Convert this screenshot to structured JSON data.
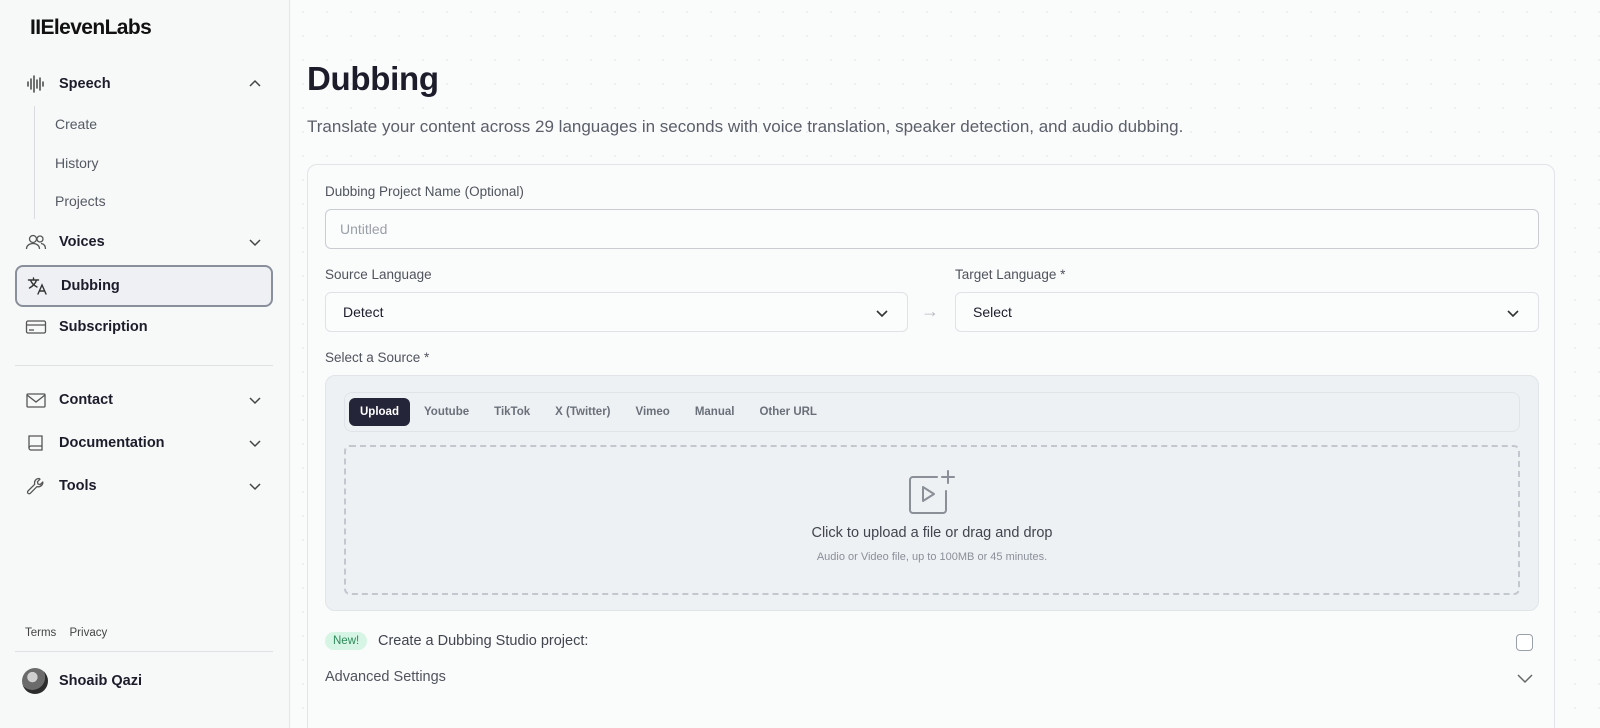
{
  "brand": {
    "logo_text": "IIElevenLabs"
  },
  "sidebar": {
    "items": [
      {
        "label": "Speech",
        "icon": "waveform-icon",
        "expanded": true
      },
      {
        "label": "Voices",
        "icon": "users-icon"
      },
      {
        "label": "Dubbing",
        "icon": "translate-icon",
        "active": true
      },
      {
        "label": "Subscription",
        "icon": "credit-card-icon"
      },
      {
        "label": "Contact",
        "icon": "mail-icon"
      },
      {
        "label": "Documentation",
        "icon": "book-icon"
      },
      {
        "label": "Tools",
        "icon": "wrench-icon"
      }
    ],
    "speech_sub": [
      "Create",
      "History",
      "Projects"
    ],
    "footer_links": [
      "Terms",
      "Privacy"
    ],
    "user": {
      "name": "Shoaib Qazi"
    }
  },
  "main": {
    "title": "Dubbing",
    "subtitle": "Translate your content across 29 languages in seconds with voice translation, speaker detection, and audio dubbing.",
    "project_name": {
      "label": "Dubbing Project Name (Optional)",
      "placeholder": "Untitled",
      "value": ""
    },
    "source_language": {
      "label": "Source Language",
      "value": "Detect"
    },
    "target_language": {
      "label": "Target Language *",
      "value": "Select"
    },
    "arrow": "→",
    "source": {
      "label": "Select a Source *",
      "tabs": [
        "Upload",
        "Youtube",
        "TikTok",
        "X (Twitter)",
        "Vimeo",
        "Manual",
        "Other URL"
      ],
      "active_tab": "Upload",
      "dropzone_title": "Click to upload a file or drag and drop",
      "dropzone_subtitle": "Audio or Video file, up to 100MB or 45 minutes."
    },
    "studio": {
      "badge": "New!",
      "label": "Create a Dubbing Studio project:",
      "checked": false
    },
    "advanced_label": "Advanced Settings"
  },
  "colors": {
    "accent_dark": "#25253a",
    "badge_bg": "#d6f5e4",
    "badge_text": "#2d8a5a"
  }
}
